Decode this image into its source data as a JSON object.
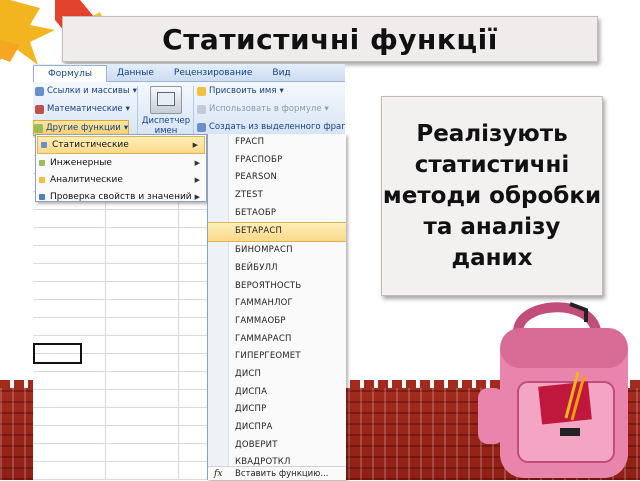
{
  "title": "Статистичні функції",
  "description": "Реалізують статистичні методи обробки та аналізу даних",
  "ribbon": {
    "tabs": [
      "Формулы",
      "Данные",
      "Рецензирование",
      "Вид"
    ],
    "left_buttons": [
      "Ссылки и массивы",
      "Математические",
      "Другие функции"
    ],
    "dispatcher_label": "Диспетчер имен",
    "right_buttons": [
      "Присвоить имя",
      "Использовать в формуле",
      "Создать из выделенного фрагмента"
    ]
  },
  "submenu": {
    "items": [
      "Статистические",
      "Инженерные",
      "Аналитические",
      "Проверка свойств и значений"
    ]
  },
  "function_list": {
    "items": [
      "FРАСП",
      "FРАСПОБР",
      "PEARSON",
      "ZTEST",
      "БЕТАОБР",
      "БЕТАРАСП",
      "БИНОМРАСП",
      "ВЕЙБУЛЛ",
      "ВЕРОЯТНОСТЬ",
      "ГАММАНЛОГ",
      "ГАММАОБР",
      "ГАММАРАСП",
      "ГИПЕРГЕОМЕТ",
      "ДИСП",
      "ДИСПА",
      "ДИСПР",
      "ДИСПРА",
      "ДОВЕРИТ",
      "КВАДРОТКЛ"
    ],
    "selected": "БЕТАРАСП",
    "insert_label": "Вставить функцию..."
  },
  "colors": {
    "ribbon_text": "#15428b",
    "highlight": "#fbd98a",
    "fence": "#a32a1e"
  }
}
